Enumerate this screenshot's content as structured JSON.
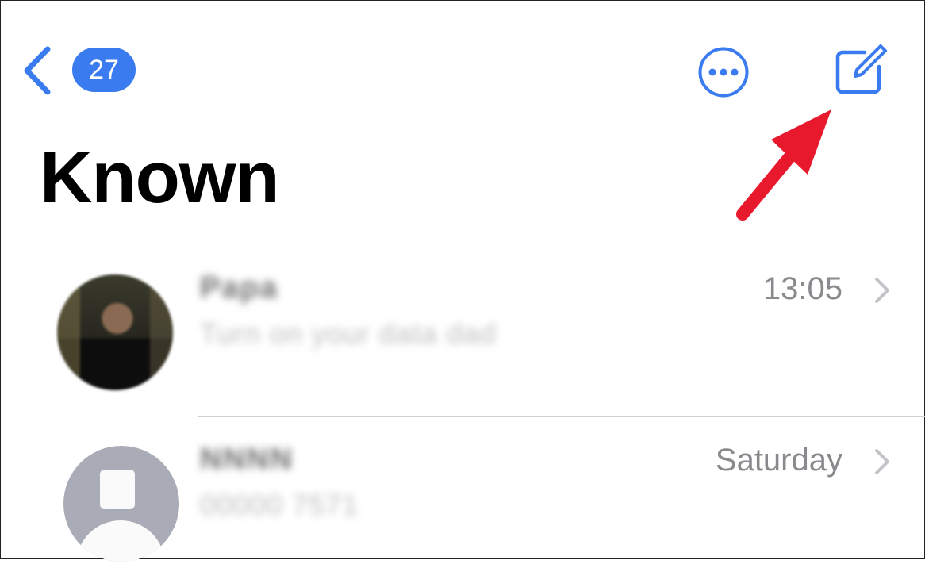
{
  "nav": {
    "unread_count": "27"
  },
  "title": "Known",
  "icons": {
    "back": "chevron-left-icon",
    "more": "ellipsis-circle-icon",
    "compose": "compose-icon",
    "row_chevron": "chevron-right-icon",
    "annotation_arrow": "arrow-icon"
  },
  "colors": {
    "accent": "#3a7bf0",
    "annotation": "#e8192c",
    "timestamp": "#8a8a8e",
    "divider": "#cfcfd3"
  },
  "conversations": [
    {
      "name": "Papa",
      "preview": "Turn on your data dad",
      "time": "13:05",
      "avatar": "photo"
    },
    {
      "name": "NNNN",
      "preview": "00000 7571",
      "time": "Saturday",
      "avatar": "placeholder"
    }
  ]
}
